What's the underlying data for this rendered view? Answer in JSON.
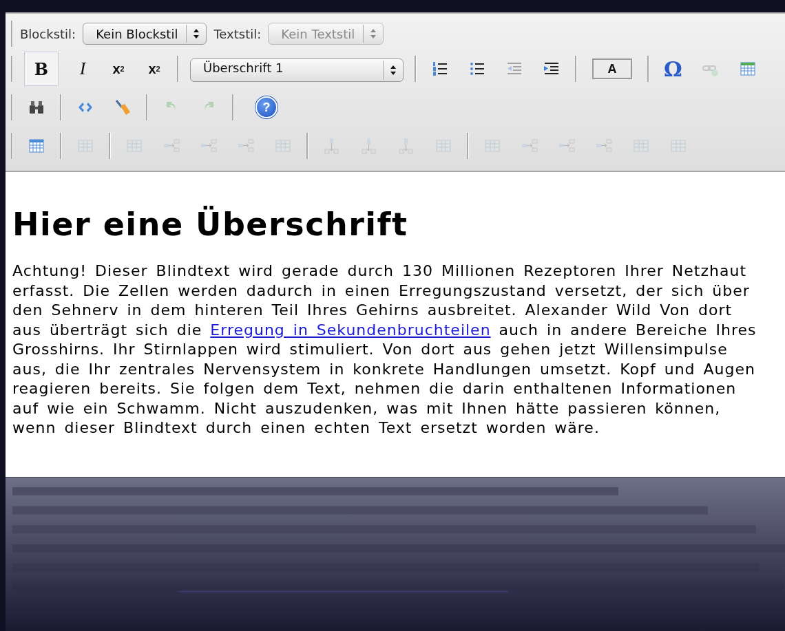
{
  "toolbar": {
    "rows": [
      {
        "kind": "styles",
        "block_label": "Blockstil:",
        "block_select": {
          "value": "Kein Blockstil",
          "disabled": false
        },
        "text_label": "Textstil:",
        "text_select": {
          "value": "Kein Textstil",
          "disabled": true
        }
      },
      {
        "kind": "buttons",
        "groups": [
          [
            {
              "kind": "bold",
              "label": "B",
              "active": true,
              "disabled": false
            },
            {
              "kind": "italic",
              "label": "I",
              "active": false,
              "disabled": false
            },
            {
              "kind": "sub",
              "label": "x",
              "index": "2",
              "active": false,
              "disabled": false
            },
            {
              "kind": "sup",
              "label": "x",
              "index": "2",
              "active": false,
              "disabled": false
            }
          ],
          [
            {
              "kind": "select",
              "value": "Überschrift 1",
              "disabled": false
            }
          ],
          [
            {
              "kind": "ordered-list",
              "disabled": false
            },
            {
              "kind": "bullet-list",
              "disabled": false
            },
            {
              "kind": "outdent",
              "disabled": true
            },
            {
              "kind": "indent",
              "disabled": false
            }
          ],
          [
            {
              "kind": "text-color",
              "label": "A",
              "disabled": false
            }
          ],
          [
            {
              "kind": "omega",
              "label": "Ω",
              "disabled": false
            },
            {
              "kind": "link",
              "disabled": true
            },
            {
              "kind": "calculator",
              "disabled": false
            }
          ]
        ]
      },
      {
        "kind": "buttons",
        "groups": [
          [
            {
              "kind": "binoculars",
              "disabled": false
            }
          ],
          [
            {
              "kind": "code",
              "disabled": false
            },
            {
              "kind": "broom",
              "disabled": false
            }
          ],
          [
            {
              "kind": "undo",
              "disabled": true
            },
            {
              "kind": "redo",
              "disabled": true
            }
          ],
          [
            {
              "kind": "help",
              "label": "?",
              "disabled": false
            }
          ]
        ]
      },
      {
        "kind": "buttons",
        "groups": [
          [
            {
              "kind": "table",
              "disabled": false
            }
          ],
          [
            {
              "kind": "grid",
              "disabled": true
            }
          ],
          [
            {
              "kind": "grid",
              "disabled": true
            },
            {
              "kind": "row-arrow",
              "disabled": true
            },
            {
              "kind": "row-arrow",
              "disabled": true
            },
            {
              "kind": "row-arrow",
              "disabled": true
            },
            {
              "kind": "grid",
              "disabled": true
            }
          ],
          [
            {
              "kind": "col-arrow",
              "disabled": true
            },
            {
              "kind": "col-arrow",
              "disabled": true
            },
            {
              "kind": "col-arrow",
              "disabled": true
            },
            {
              "kind": "grid",
              "disabled": true
            }
          ],
          [
            {
              "kind": "grid",
              "disabled": true
            },
            {
              "kind": "row-arrow",
              "disabled": true
            },
            {
              "kind": "row-arrow",
              "disabled": true
            },
            {
              "kind": "row-arrow",
              "disabled": true
            },
            {
              "kind": "grid",
              "disabled": true
            },
            {
              "kind": "grid",
              "disabled": true
            }
          ]
        ]
      }
    ]
  },
  "heading": "Hier eine Überschrift",
  "paragraph_lines": [
    [
      {
        "kind": "text",
        "text": "Achtung! Dieser Blindtext wird gerade durch 130 Millionen Rezeptoren Ihrer Netzhaut"
      }
    ],
    [
      {
        "kind": "text",
        "text": "erfasst. Die Zellen werden dadurch in einen Erregungszustand versetzt, der sich über"
      }
    ],
    [
      {
        "kind": "text",
        "text": "den Sehnerv in dem hinteren Teil Ihres Gehirns ausbreitet. Alexander Wild Von dort"
      }
    ],
    [
      {
        "kind": "text",
        "text": "aus überträgt sich die "
      },
      {
        "kind": "link",
        "text": "Erregung in Sekundenbruchteilen"
      },
      {
        "kind": "text",
        "text": " auch in andere Bereiche Ihres"
      }
    ],
    [
      {
        "kind": "text",
        "text": "Grosshirns. Ihr Stirnlappen wird stimuliert. Von dort aus gehen jetzt Willensimpulse"
      }
    ],
    [
      {
        "kind": "text",
        "text": "aus, die Ihr zentrales Nervensystem in konkrete Handlungen umsetzt. Kopf und Augen"
      }
    ],
    [
      {
        "kind": "text",
        "text": "reagieren bereits. Sie folgen dem Text, nehmen die darin enthaltenen Informationen"
      }
    ],
    [
      {
        "kind": "text",
        "text": "auf wie ein Schwamm. Nicht auszudenken, was mit Ihnen hätte passieren können,"
      }
    ],
    [
      {
        "kind": "text",
        "text": "wenn dieser Blindtext durch einen echten Text ersetzt worden wäre."
      }
    ]
  ]
}
